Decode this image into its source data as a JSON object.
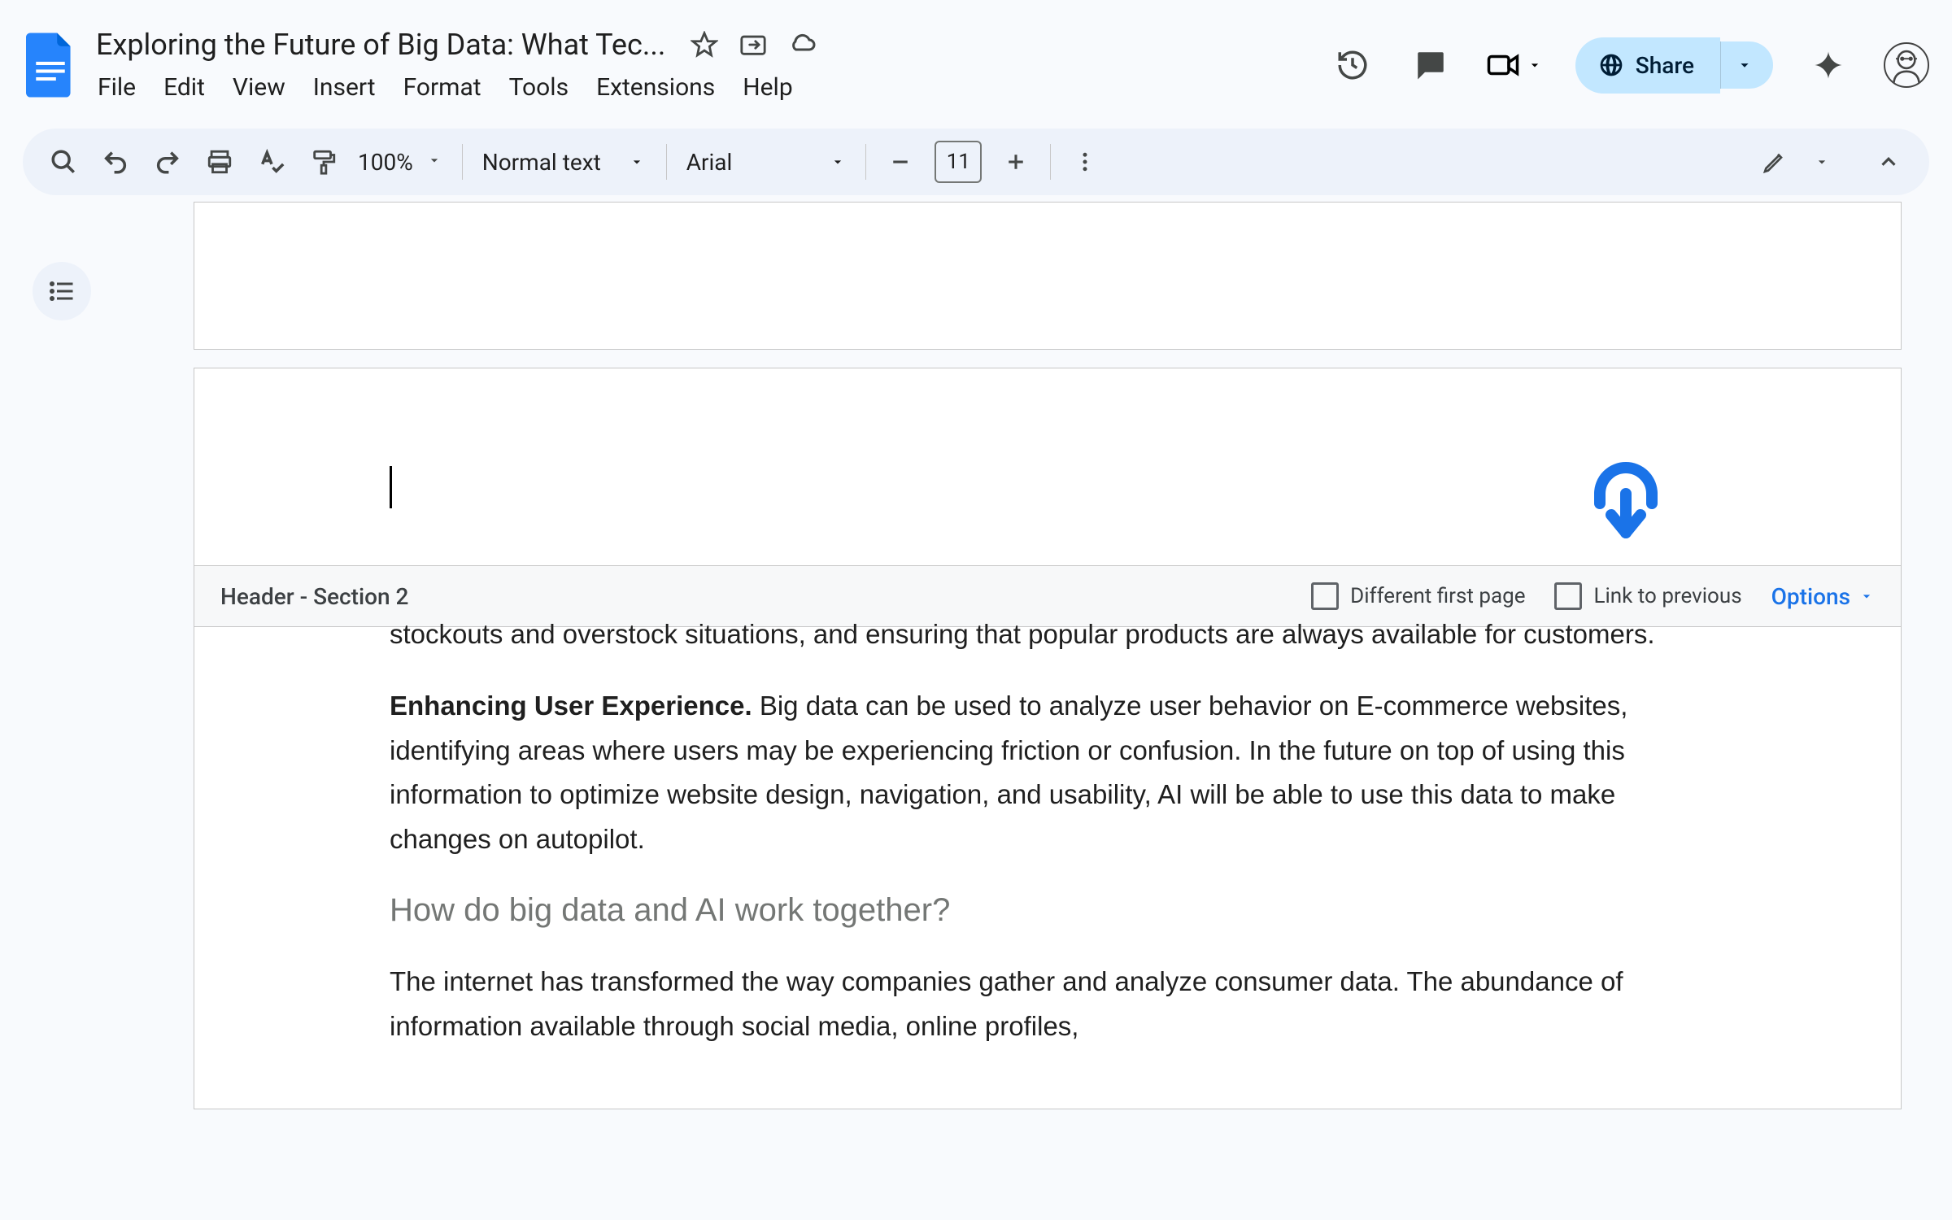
{
  "header": {
    "doc_title": "Exploring the Future of Big Data: What Tec...",
    "menus": [
      "File",
      "Edit",
      "View",
      "Insert",
      "Format",
      "Tools",
      "Extensions",
      "Help"
    ],
    "share_label": "Share"
  },
  "toolbar": {
    "zoom": "100%",
    "text_style": "Normal text",
    "font": "Arial",
    "font_size": "11"
  },
  "header_bar": {
    "label": "Header - Section 2",
    "checkbox_diff": "Different first page",
    "checkbox_link": "Link to previous",
    "options": "Options"
  },
  "doc": {
    "para1": "stockouts and overstock situations, and ensuring that popular products are always available for customers.",
    "para2_bold": "Enhancing User Experience.",
    "para2_rest": " Big data can be used to analyze user behavior on E-commerce websites, identifying areas where users may be experiencing friction or confusion. In the future on top of using this information to optimize website design, navigation, and usability, AI will be able to use this data to make changes on autopilot.",
    "heading": "How do big data and AI work together?",
    "para3": "The internet has transformed the way companies gather and analyze consumer data. The abundance of information available through social media, online profiles,"
  }
}
